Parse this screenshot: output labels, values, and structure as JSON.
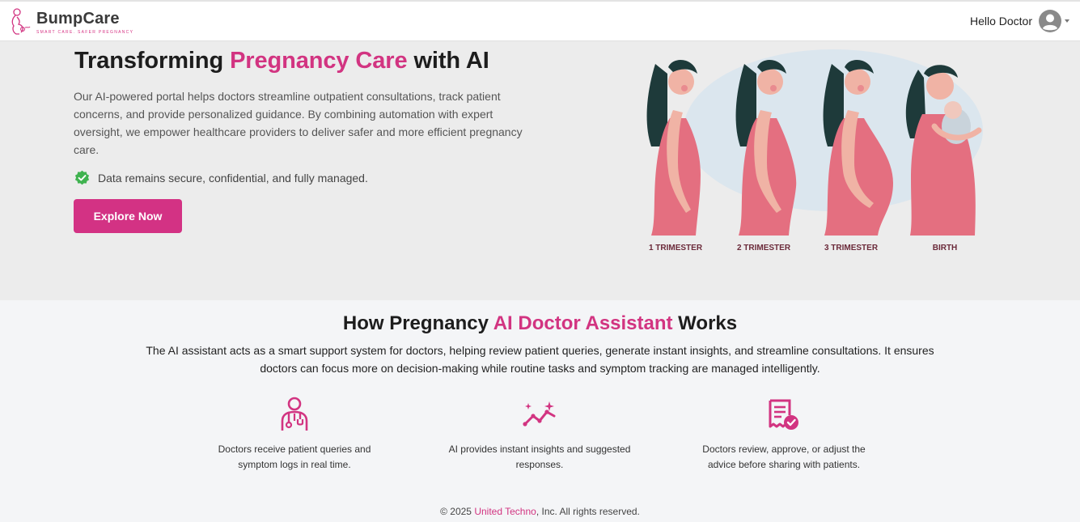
{
  "header": {
    "brand_name": "BumpCare",
    "brand_tagline": "SMART CARE. SAFER PREGNANCY",
    "greeting": "Hello Doctor"
  },
  "hero": {
    "title_start": "Transforming ",
    "title_highlight": "Pregnancy Care",
    "title_end": " with AI",
    "description": "Our AI-powered portal helps doctors streamline outpatient consultations, track patient concerns, and provide personalized guidance. By combining automation with expert oversight, we empower healthcare providers to deliver safer and more efficient pregnancy care.",
    "secure_note": "Data remains secure, confidential, and fully managed.",
    "cta_label": "Explore Now",
    "stages": [
      "1 TRIMESTER",
      "2 TRIMESTER",
      "3 TRIMESTER",
      "BIRTH"
    ]
  },
  "how": {
    "title_start": "How Pregnancy ",
    "title_highlight": "AI Doctor Assistant",
    "title_end": " Works",
    "description": "The AI assistant acts as a smart support system for doctors, helping review patient queries, generate instant insights, and streamline consultations. It ensures doctors can focus more on decision-making while routine tasks and symptom tracking are managed intelligently.",
    "steps": [
      {
        "icon": "doctor-icon",
        "text": "Doctors receive patient queries and symptom logs in real time."
      },
      {
        "icon": "ai-insights-icon",
        "text": "AI provides instant insights and suggested responses."
      },
      {
        "icon": "approval-document-icon",
        "text": "Doctors review, approve, or adjust the advice before sharing with patients."
      }
    ]
  },
  "footer": {
    "prefix": "© 2025 ",
    "company": "United Techno",
    "suffix": ", Inc. All rights reserved."
  },
  "colors": {
    "accent": "#d23481",
    "hero_background": "#ececec",
    "page_background": "#f4f5f7"
  }
}
